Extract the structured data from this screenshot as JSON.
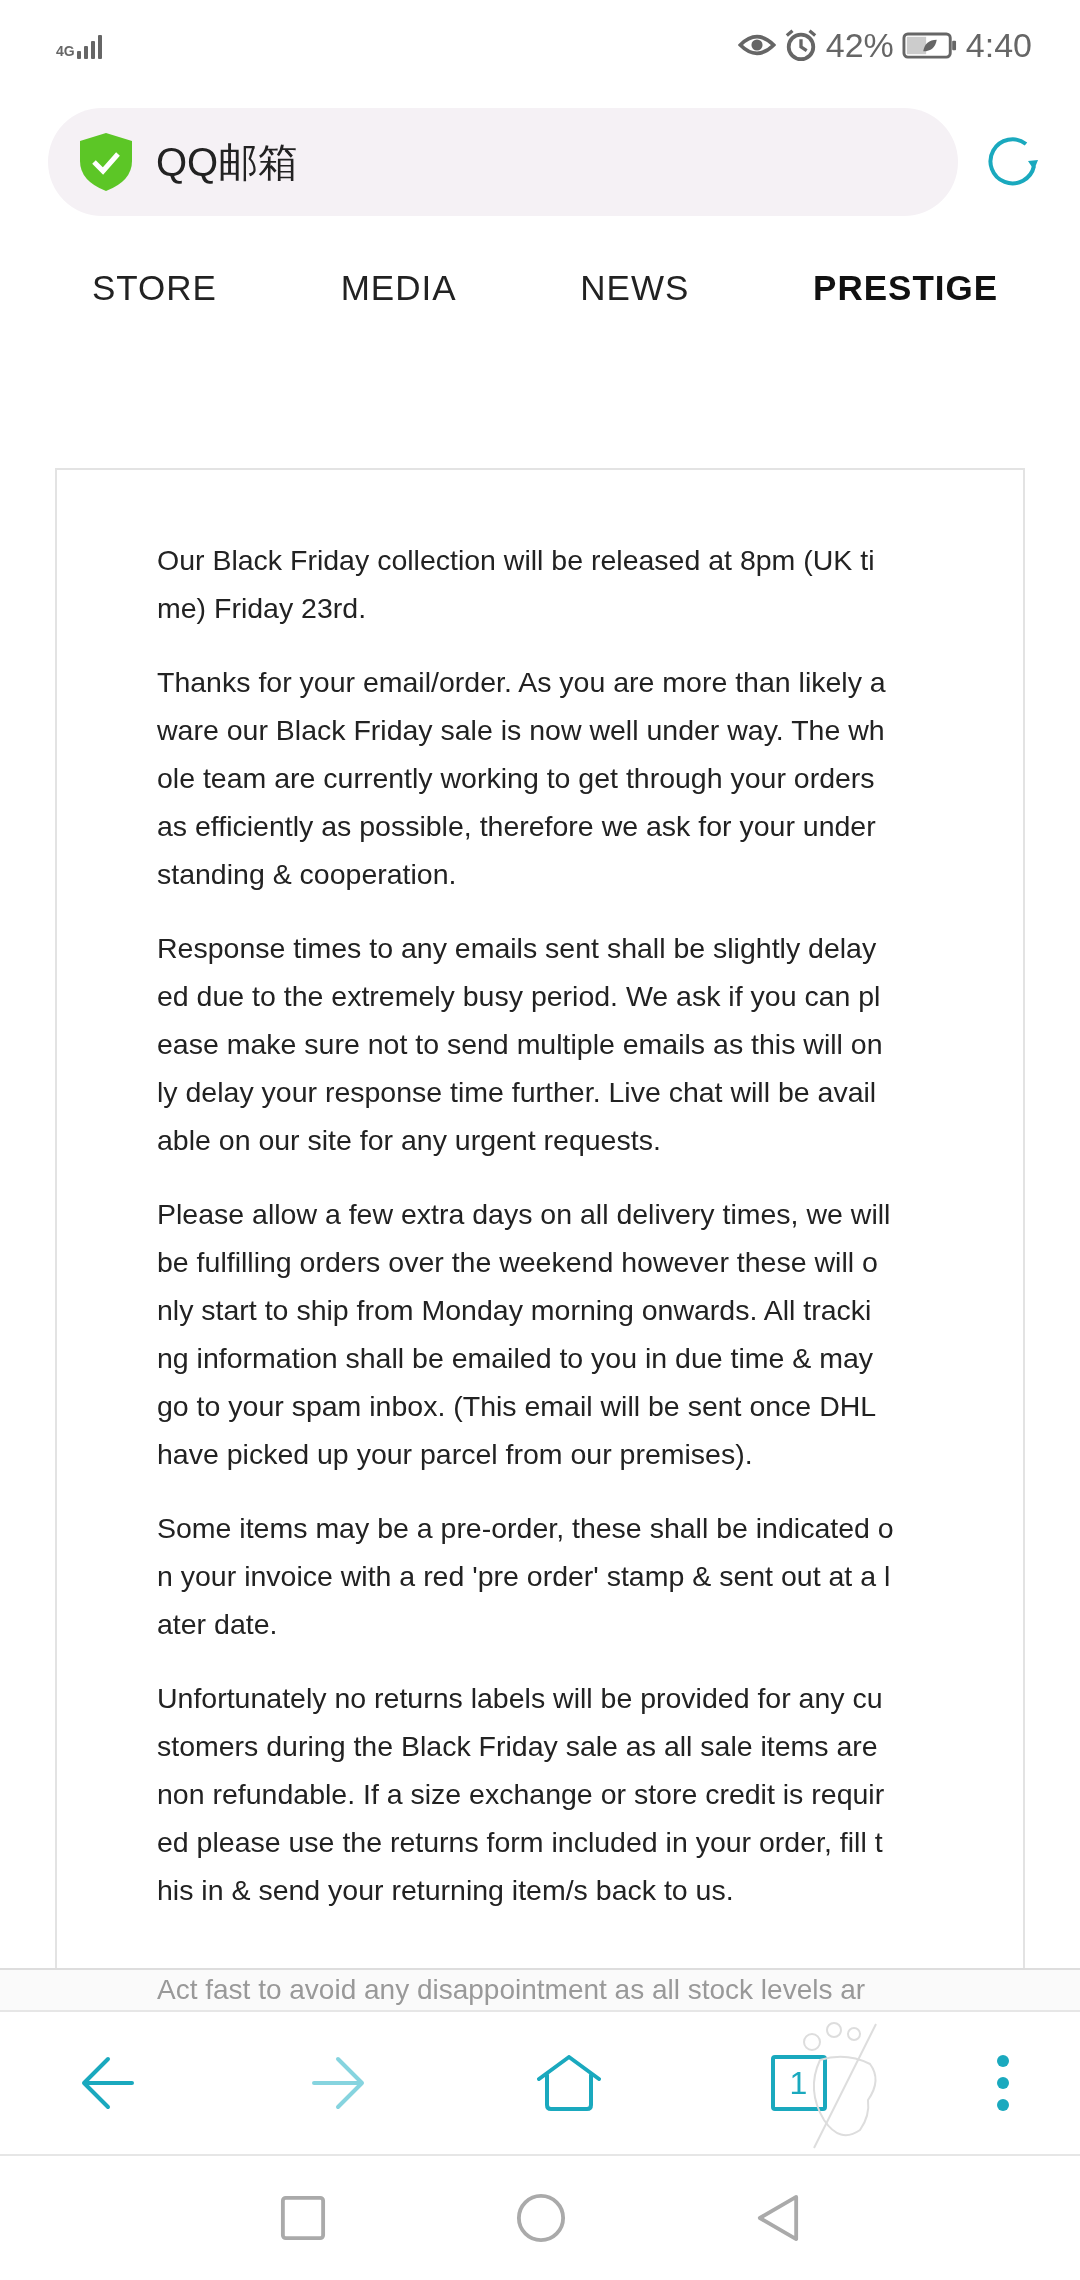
{
  "status_bar": {
    "network": "4G",
    "battery": "42%",
    "time": "4:40"
  },
  "address_bar": {
    "title": "QQ邮箱",
    "secure": true
  },
  "tabs": [
    {
      "label": "STORE",
      "selected": false
    },
    {
      "label": "MEDIA",
      "selected": false
    },
    {
      "label": "NEWS",
      "selected": false
    },
    {
      "label": "PRESTIGE",
      "selected": true
    }
  ],
  "message": {
    "paragraphs": [
      [
        "Our Black Friday collection will be released at 8pm (UK ti",
        "me) Friday 23rd."
      ],
      [
        "Thanks for your email/order. As you are more than likely a",
        "ware our Black Friday sale is now well under way. The wh",
        "ole team are currently working to get through your orders",
        "as efficiently as possible, therefore we ask for your under",
        "standing & cooperation."
      ],
      [
        "Response times to any emails sent shall be slightly delay",
        "ed due to the extremely busy period. We ask if you can pl",
        "ease make sure not to send multiple emails as this will on",
        "ly delay your response time further. Live chat will be avail",
        "able on our site for any urgent requests."
      ],
      [
        "Please allow a few extra days on all delivery times, we will",
        "be fulfilling orders over the weekend however these will o",
        "nly start to ship from Monday morning onwards. All tracki",
        "ng information shall be emailed to you in due time & may",
        "go to your spam inbox. (This email will be sent once DHL",
        "have picked up your parcel from our premises)."
      ],
      [
        "Some items may be a pre-order, these shall be indicated o",
        "n your invoice with a red 'pre order' stamp & sent out at a l",
        "ater date."
      ],
      [
        "Unfortunately no returns labels will be provided for any cu",
        "stomers during the Black Friday sale as all sale items are",
        "non refundable. If a size exchange or store credit is requir",
        "ed please use the returns form included in your order, fill t",
        "his in & send your returning item/s back to us."
      ]
    ],
    "partial_line": "Act fast to avoid any disappointment as all stock levels ar"
  },
  "toolbar": {
    "back_disabled": false,
    "forward_disabled": true,
    "tab_count": "1"
  }
}
